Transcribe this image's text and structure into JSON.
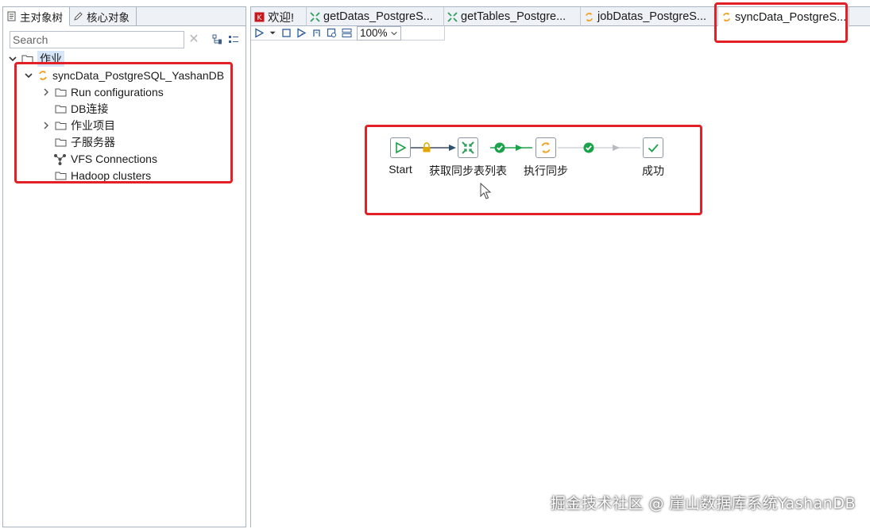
{
  "left_panel": {
    "tabs": [
      {
        "label": "主对象树",
        "icon": "document-icon"
      },
      {
        "label": "核心对象",
        "icon": "pencil-icon"
      }
    ],
    "search": {
      "placeholder": "Search",
      "value": ""
    },
    "tree": {
      "root": {
        "label": "作业"
      },
      "job": {
        "label": "syncData_PostgreSQL_YashanDB"
      },
      "children": [
        {
          "label": "Run configurations",
          "expandable": true
        },
        {
          "label": "DB连接",
          "expandable": false
        },
        {
          "label": "作业项目",
          "expandable": true
        },
        {
          "label": "子服务器",
          "expandable": false
        },
        {
          "label": "VFS Connections",
          "expandable": false
        },
        {
          "label": "Hadoop clusters",
          "expandable": false
        }
      ]
    }
  },
  "editor": {
    "tabs": [
      {
        "label": "欢迎!",
        "icon": "welcome-icon"
      },
      {
        "label": "getDatas_PostgreS...",
        "icon": "transform-icon"
      },
      {
        "label": "getTables_Postgre...",
        "icon": "transform-icon"
      },
      {
        "label": "jobDatas_PostgreS...",
        "icon": "job-icon"
      },
      {
        "label": "syncData_PostgreS...",
        "icon": "job-icon",
        "active": true
      }
    ],
    "zoom": "100%"
  },
  "workflow": {
    "nodes": [
      {
        "label": "Start",
        "icon": "start-icon"
      },
      {
        "label": "获取同步表列表",
        "icon": "transform-icon"
      },
      {
        "label": "执行同步",
        "icon": "job-icon"
      },
      {
        "label": "成功",
        "icon": "success-icon"
      }
    ],
    "hops": [
      {
        "from": "Start",
        "to": "获取同步表列表",
        "type": "unconditional"
      },
      {
        "from": "获取同步表列表",
        "to": "执行同步",
        "type": "on-success"
      },
      {
        "from": "执行同步",
        "to": "成功",
        "type": "on-success"
      }
    ]
  },
  "colors": {
    "highlight_box": "#e32026",
    "success_green": "#1aa34a",
    "lock_amber": "#e0a800",
    "job_orange": "#f0a020",
    "transform_green": "#2e9e5b"
  },
  "watermark": "掘金技术社区 @ 崖山数据库系统YashanDB"
}
